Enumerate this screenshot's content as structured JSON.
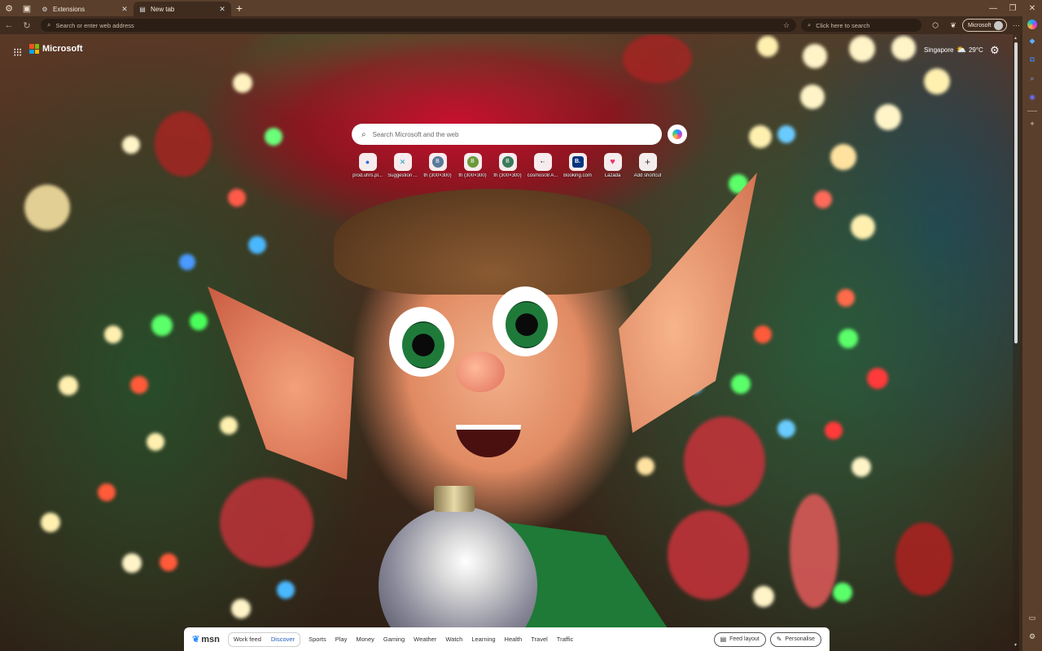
{
  "browser": {
    "tabs": [
      {
        "label": "Extensions",
        "icon": "extensions-icon",
        "active": false
      },
      {
        "label": "New tab",
        "icon": "new-tab-page-icon",
        "active": true
      }
    ],
    "address_placeholder": "Search or enter web address",
    "side_search_placeholder": "Click here to search",
    "profile_label": "Microsoft"
  },
  "ntp": {
    "brand": "Microsoft",
    "weather": {
      "city": "Singapore",
      "temp": "29°C"
    },
    "search_placeholder": "Search Microsoft and the web",
    "shortcuts": [
      {
        "label": "prod.uhrs.pl...",
        "icon": "uhrs-icon"
      },
      {
        "label": "Suggestion ...",
        "icon": "suggestion-icon"
      },
      {
        "label": "th (300×300)",
        "icon": "th-icon"
      },
      {
        "label": "th (300×300)",
        "icon": "th-icon"
      },
      {
        "label": "th (300×300)",
        "icon": "th-icon"
      },
      {
        "label": "cosmos08 A...",
        "icon": "cosmos-icon"
      },
      {
        "label": "Booking.com",
        "icon": "booking-icon"
      },
      {
        "label": "Lazada",
        "icon": "lazada-icon"
      },
      {
        "label": "Add shortcut",
        "icon": "plus-icon"
      }
    ]
  },
  "msn": {
    "logo": "msn",
    "feed_tabs": [
      "Work feed",
      "Discover"
    ],
    "links": [
      "Sports",
      "Play",
      "Money",
      "Gaming",
      "Weather",
      "Watch",
      "Learning",
      "Health",
      "Travel",
      "Traffic"
    ],
    "feed_layout": "Feed layout",
    "personalise": "Personalise"
  },
  "colors": {
    "ms_red": "#f25022",
    "ms_green": "#7fba00",
    "ms_blue": "#00a4ef",
    "ms_yellow": "#ffb900",
    "discover_active": "#1f5fbf"
  }
}
